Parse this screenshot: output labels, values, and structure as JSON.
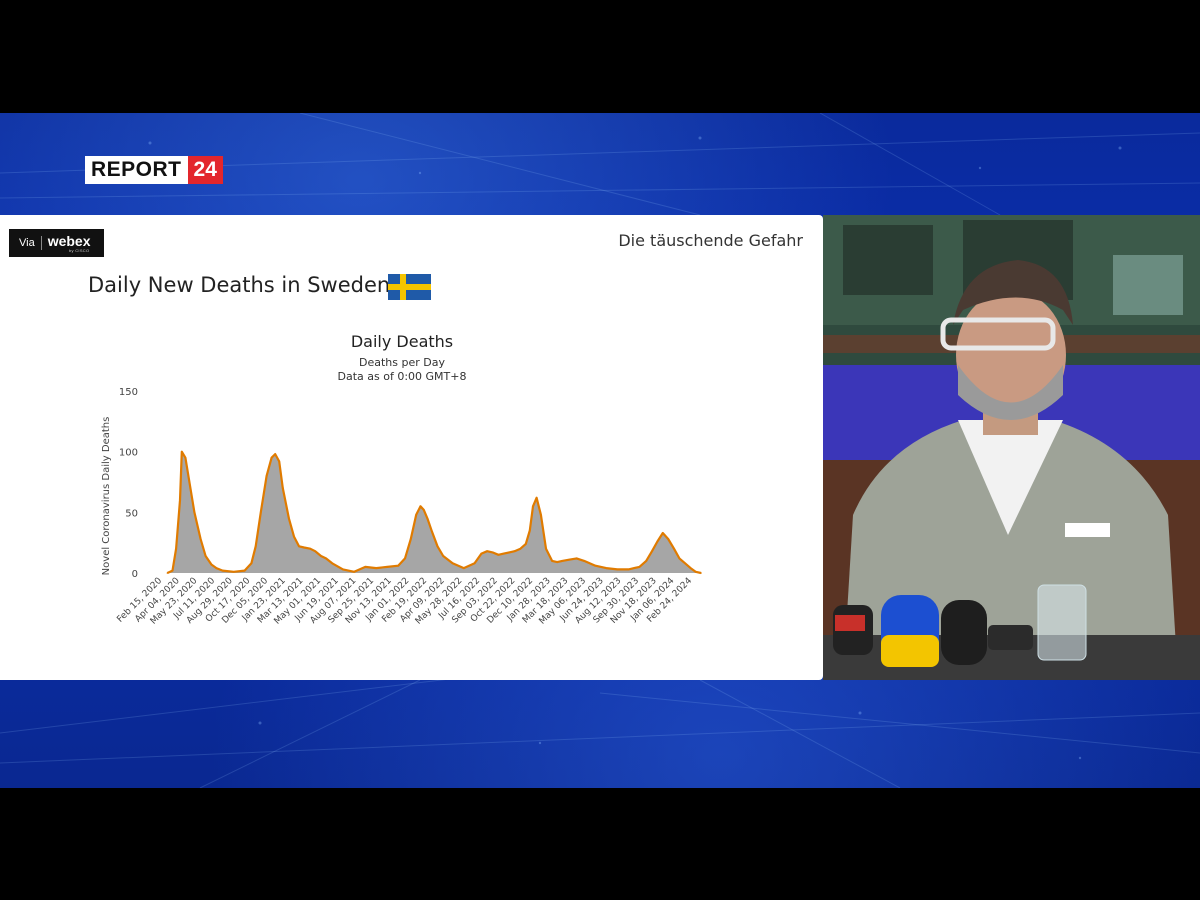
{
  "broadcast": {
    "logo_word": "REPORT",
    "logo_number": "24"
  },
  "slide": {
    "badge_via": "Via",
    "badge_brand": "webex",
    "badge_sub": "by CISCO",
    "top_right_text": "Die täuschende Gefahr",
    "title": "Daily New Deaths in Sweden"
  },
  "chart_data": {
    "type": "area",
    "title": "Daily Deaths",
    "subtitle": "Deaths per Day",
    "subtitle2": "Data as of 0:00 GMT+8",
    "ylabel": "Novel Coronavirus Daily Deaths",
    "ylim": [
      0,
      150
    ],
    "yticks": [
      0,
      50,
      100,
      150
    ],
    "xticks": [
      "Feb 15, 2020",
      "Apr 04, 2020",
      "May 23, 2020",
      "Jul 11, 2020",
      "Aug 29, 2020",
      "Oct 17, 2020",
      "Dec 05, 2020",
      "Jan 23, 2021",
      "Mar 13, 2021",
      "May 01, 2021",
      "Jun 19, 2021",
      "Aug 07, 2021",
      "Sep 25, 2021",
      "Nov 13, 2021",
      "Jan 01, 2022",
      "Feb 19, 2022",
      "Apr 09, 2022",
      "May 28, 2022",
      "Jul 16, 2022",
      "Sep 03, 2022",
      "Oct 22, 2022",
      "Dec 10, 2022",
      "Jan 28, 2023",
      "Mar 18, 2023",
      "May 06, 2023",
      "Jun 24, 2023",
      "Aug 12, 2023",
      "Sep 30, 2023",
      "Nov 18, 2023",
      "Jan 06, 2024",
      "Feb 24, 2024"
    ],
    "series": [
      {
        "name": "",
        "color_area": "#a6a6a6",
        "color_line": "#e07b00",
        "x": [
          "2020-03-01",
          "2020-03-15",
          "2020-03-25",
          "2020-04-05",
          "2020-04-10",
          "2020-04-20",
          "2020-05-01",
          "2020-05-15",
          "2020-06-01",
          "2020-06-15",
          "2020-07-01",
          "2020-07-15",
          "2020-08-01",
          "2020-09-01",
          "2020-10-01",
          "2020-10-20",
          "2020-11-01",
          "2020-11-15",
          "2020-12-01",
          "2020-12-15",
          "2020-12-25",
          "2021-01-05",
          "2021-01-15",
          "2021-02-01",
          "2021-02-15",
          "2021-03-01",
          "2021-03-15",
          "2021-04-01",
          "2021-04-15",
          "2021-05-01",
          "2021-05-15",
          "2021-06-01",
          "2021-07-01",
          "2021-08-01",
          "2021-09-01",
          "2021-10-01",
          "2021-11-01",
          "2021-12-01",
          "2021-12-20",
          "2022-01-05",
          "2022-01-20",
          "2022-02-01",
          "2022-02-10",
          "2022-02-20",
          "2022-03-05",
          "2022-03-20",
          "2022-04-05",
          "2022-05-01",
          "2022-06-01",
          "2022-07-01",
          "2022-07-20",
          "2022-08-05",
          "2022-08-20",
          "2022-09-05",
          "2022-09-20",
          "2022-10-05",
          "2022-10-20",
          "2022-11-05",
          "2022-11-20",
          "2022-12-01",
          "2022-12-10",
          "2022-12-20",
          "2023-01-01",
          "2023-01-15",
          "2023-02-01",
          "2023-02-15",
          "2023-03-01",
          "2023-03-20",
          "2023-04-10",
          "2023-05-01",
          "2023-06-01",
          "2023-07-01",
          "2023-08-01",
          "2023-09-01",
          "2023-10-01",
          "2023-10-20",
          "2023-11-05",
          "2023-11-20",
          "2023-12-05",
          "2023-12-20",
          "2024-01-05",
          "2024-01-20",
          "2024-02-05",
          "2024-02-20",
          "2024-03-05",
          "2024-03-20"
        ],
        "y": [
          0,
          2,
          20,
          60,
          100,
          95,
          75,
          50,
          28,
          14,
          7,
          4,
          2,
          1,
          2,
          8,
          22,
          50,
          80,
          95,
          98,
          92,
          70,
          45,
          30,
          22,
          21,
          20,
          18,
          14,
          12,
          8,
          3,
          1,
          5,
          4,
          5,
          6,
          12,
          28,
          48,
          55,
          52,
          45,
          34,
          22,
          14,
          8,
          4,
          8,
          16,
          18,
          17,
          15,
          16,
          17,
          18,
          20,
          24,
          35,
          55,
          62,
          48,
          20,
          10,
          9,
          10,
          11,
          12,
          10,
          6,
          4,
          3,
          3,
          5,
          10,
          18,
          26,
          33,
          28,
          20,
          12,
          8,
          4,
          1,
          0
        ]
      }
    ]
  }
}
